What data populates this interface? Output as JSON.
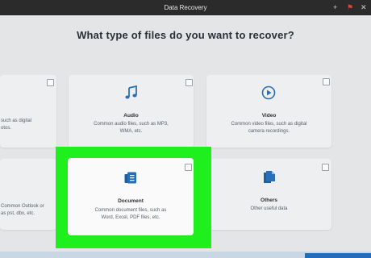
{
  "window": {
    "title": "Data Recovery",
    "controls": [
      "add-icon",
      "flag-icon",
      "close-icon"
    ]
  },
  "heading": "What type of files do you want to recover?",
  "cards": {
    "left_top": {
      "desc_line1": "such as digital",
      "desc_line2": "otos."
    },
    "audio": {
      "title": "Audio",
      "desc_line1": "Common audio files, such as MP3,",
      "desc_line2": "WMA, etc.",
      "icon": "music-note-icon"
    },
    "video": {
      "title": "Video",
      "desc_line1": "Common video files, such as digital",
      "desc_line2": "camera recordings.",
      "icon": "play-icon"
    },
    "left_bottom": {
      "desc_line1": "Common Outlook or",
      "desc_line2": "as pst, dbx, etc."
    },
    "document": {
      "title": "Document",
      "desc_line1": "Common document files, such as",
      "desc_line2": "Word, Excel, PDF files, etc.",
      "icon": "document-icon"
    },
    "others": {
      "title": "Others",
      "desc_line1": "Other useful data",
      "icon": "files-icon"
    }
  },
  "colors": {
    "accent_blue": "#2a6fb5",
    "highlight_green": "#1ff01d",
    "titlebar": "#2b2b2b"
  }
}
